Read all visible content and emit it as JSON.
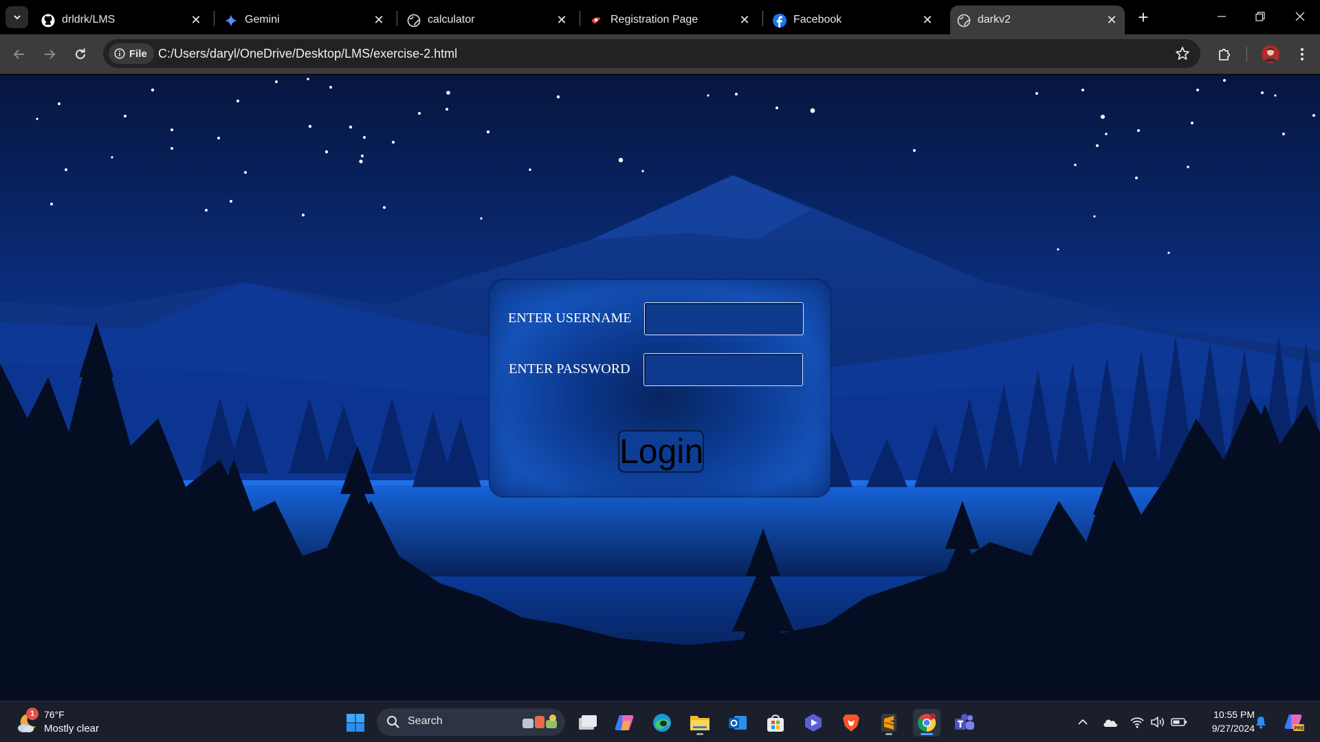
{
  "browser": {
    "tabs": [
      {
        "label": "drldrk/LMS",
        "icon": "github-icon",
        "active": false
      },
      {
        "label": "Gemini",
        "icon": "gemini-icon",
        "active": false
      },
      {
        "label": "calculator",
        "icon": "globe-icon",
        "active": false
      },
      {
        "label": "Registration Page",
        "icon": "registration-favicon-icon",
        "active": false
      },
      {
        "label": "Facebook",
        "icon": "facebook-icon",
        "active": false
      },
      {
        "label": "darkv2",
        "icon": "globe-icon",
        "active": true
      }
    ],
    "address": {
      "chip_label": "File",
      "url": "C:/Users/daryl/OneDrive/Desktop/LMS/exercise-2.html"
    }
  },
  "login_form": {
    "username_label": "ENTER USERNAME",
    "username_value": "",
    "password_label": "ENTER PASSWORD",
    "password_value": "",
    "login_button": "Login"
  },
  "taskbar": {
    "weather": {
      "temp": "76°F",
      "condition": "Mostly clear",
      "badge": "1"
    },
    "search_label": "Search",
    "apps": [
      "start-icon",
      "search",
      "widgets-icon",
      "task-view-icon",
      "copilot-icon",
      "edge-icon",
      "file-explorer-icon",
      "outlook-icon",
      "microsoft-store-icon",
      "media-player-icon",
      "brave-icon",
      "sublime-text-icon",
      "chrome-icon",
      "teams-icon"
    ],
    "clock": {
      "time": "10:55 PM",
      "date": "9/27/2024"
    }
  },
  "colors": {
    "tab_active": "#3c3c3c",
    "toolbar": "#3c3c3c",
    "omnibox": "#222222",
    "card_blue": "#1552b8",
    "taskbar": "#1a1f2b"
  }
}
